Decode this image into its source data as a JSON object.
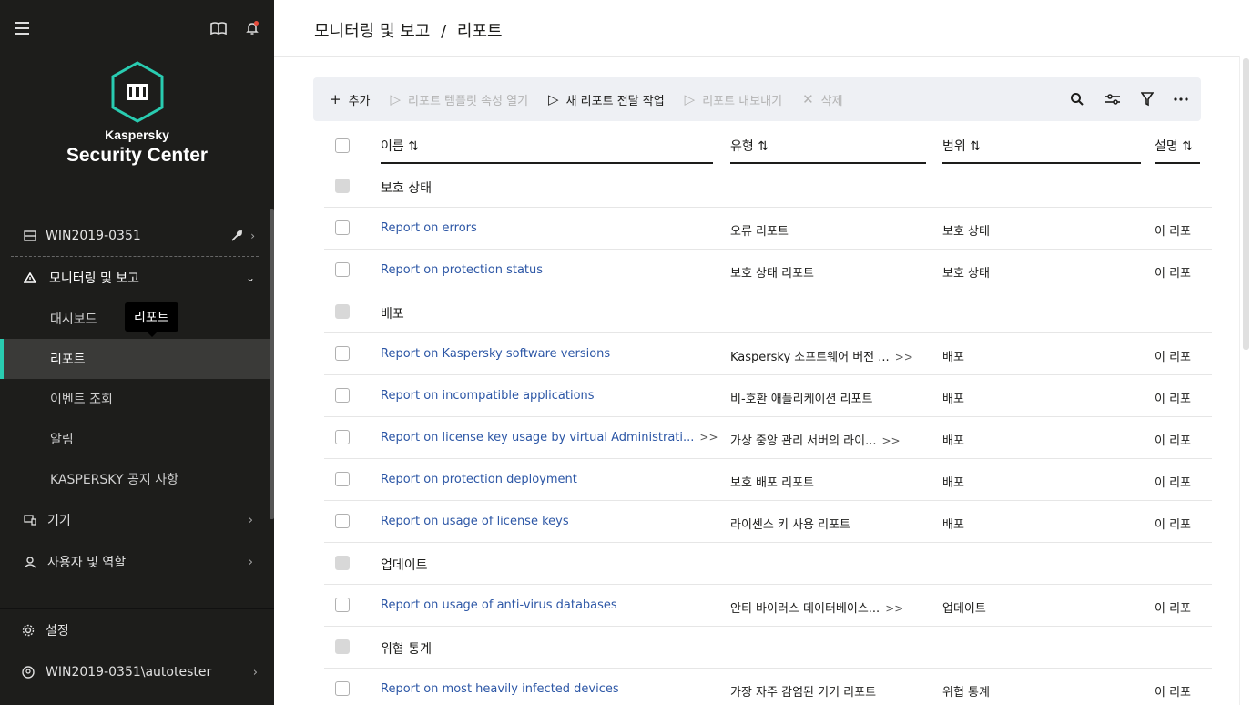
{
  "sidebar": {
    "brand_small": "Kaspersky",
    "brand_big": "Security Center",
    "server": "WIN2019-0351",
    "section": "모니터링 및 보고",
    "sub_items": [
      {
        "label": "대시보드"
      },
      {
        "label": "리포트"
      },
      {
        "label": "이벤트 조회"
      },
      {
        "label": "알림"
      },
      {
        "label": "KASPERSKY 공지 사항"
      }
    ],
    "devices": "기기",
    "users": "사용자 및 역할",
    "settings": "설정",
    "account": "WIN2019-0351\\autotester",
    "tooltip": "리포트",
    "accent": "#29ccb1"
  },
  "breadcrumb": {
    "part1": "모니터링 및 보고",
    "sep": "/",
    "part2": "리포트"
  },
  "toolbar": {
    "add": "추가",
    "open_template": "리포트 템플릿 속성 열기",
    "new_task": "새 리포트 전달 작업",
    "export": "리포트 내보내기",
    "delete": "삭제"
  },
  "table": {
    "headers": {
      "name": "이름 ⇅",
      "type": "유형 ⇅",
      "scope": "범위 ⇅",
      "desc": "설명 ⇅"
    },
    "rows": [
      {
        "group": "보호 상태"
      },
      {
        "name": "Report on errors",
        "type": "오류 리포트",
        "scope": "보호 상태",
        "desc": "이 리포"
      },
      {
        "name": "Report on protection status",
        "type": "보호 상태 리포트",
        "scope": "보호 상태",
        "desc": "이 리포"
      },
      {
        "group": "배포"
      },
      {
        "name": "Report on Kaspersky software versions",
        "type": "Kaspersky 소프트웨어 버전 ...",
        "type_more": ">>",
        "scope": "배포",
        "desc": "이 리포"
      },
      {
        "name": "Report on incompatible applications",
        "type": "비-호환 애플리케이션 리포트",
        "scope": "배포",
        "desc": "이 리포"
      },
      {
        "name": "Report on license key usage by virtual Administrati...",
        "name_more": ">>",
        "type": "가상 중앙 관리 서버의 라이...",
        "type_more": ">>",
        "scope": "배포",
        "desc": "이 리포"
      },
      {
        "name": "Report on protection deployment",
        "type": "보호 배포 리포트",
        "scope": "배포",
        "desc": "이 리포"
      },
      {
        "name": "Report on usage of license keys",
        "type": "라이센스 키 사용 리포트",
        "scope": "배포",
        "desc": "이 리포"
      },
      {
        "group": "업데이트"
      },
      {
        "name": "Report on usage of anti-virus databases",
        "type": "안티 바이러스 데이터베이스...",
        "type_more": ">>",
        "scope": "업데이트",
        "desc": "이 리포"
      },
      {
        "group": "위협 통계"
      },
      {
        "name": "Report on most heavily infected devices",
        "type": "가장 자주 감염된 기기 리포트",
        "scope": "위협 통계",
        "desc": "이 리포"
      }
    ]
  }
}
